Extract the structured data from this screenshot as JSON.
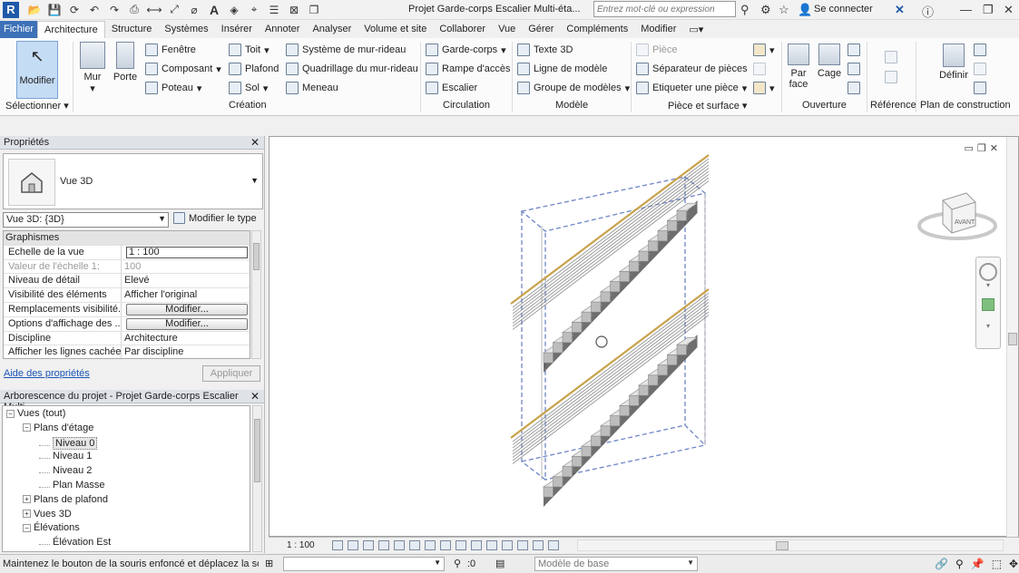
{
  "titlebar": {
    "app_letter": "R",
    "document_title": "Projet Garde-corps Escalier Multi-éta...",
    "search_placeholder": "Entrez mot-clé ou expression",
    "signin_label": "Se connecter"
  },
  "menu_tabs": [
    "Fichier",
    "Architecture",
    "Structure",
    "Systèmes",
    "Insérer",
    "Annoter",
    "Analyser",
    "Volume et site",
    "Collaborer",
    "Vue",
    "Gérer",
    "Compléments",
    "Modifier"
  ],
  "active_tab": "Architecture",
  "ribbon": {
    "select": {
      "modify_label": "Modifier",
      "panel_label": "Sélectionner"
    },
    "build": {
      "wall_label": "Mur",
      "door_label": "Porte",
      "window_label": "Fenêtre",
      "component_label": "Composant",
      "column_label": "Poteau",
      "roof_label": "Toit",
      "ceiling_label": "Plafond",
      "floor_label": "Sol",
      "curtain_system_label": "Système de mur-rideau",
      "curtain_grid_label": "Quadrillage du mur-rideau",
      "mullion_label": "Meneau",
      "panel_label": "Création"
    },
    "circulation": {
      "railing_label": "Garde-corps",
      "ramp_label": "Rampe d'accès",
      "stair_label": "Escalier",
      "panel_label": "Circulation"
    },
    "model": {
      "text_label": "Texte 3D",
      "line_label": "Ligne de modèle",
      "group_label": "Groupe de modèles",
      "panel_label": "Modèle"
    },
    "room": {
      "room_label": "Pièce",
      "separator_label": "Séparateur de pièces",
      "tag_label": "Etiqueter une pièce",
      "panel_label": "Pièce et surface"
    },
    "opening": {
      "by_face_label": "Par face",
      "shaft_label": "Cage",
      "panel_label": "Ouverture"
    },
    "datum": {
      "panel_label": "Référence"
    },
    "workplane": {
      "set_label": "Définir",
      "panel_label": "Plan de construction"
    }
  },
  "properties": {
    "header": "Propriétés",
    "type_name": "Vue 3D",
    "view_selector": "Vue 3D: {3D}",
    "edit_type_label": "Modifier le type",
    "group_label": "Graphismes",
    "rows": [
      {
        "key": "Echelle de la vue",
        "value": "1 : 100",
        "kind": "input"
      },
      {
        "key": "Valeur de l'échelle    1:",
        "value": "100",
        "kind": "dim"
      },
      {
        "key": "Niveau de détail",
        "value": "Elevé",
        "kind": "text"
      },
      {
        "key": "Visibilité des éléments",
        "value": "Afficher l'original",
        "kind": "text"
      },
      {
        "key": "Remplacements visibilité...",
        "value": "Modifier...",
        "kind": "button"
      },
      {
        "key": "Options d'affichage des ...",
        "value": "Modifier...",
        "kind": "button"
      },
      {
        "key": "Discipline",
        "value": "Architecture",
        "kind": "text"
      },
      {
        "key": "Afficher les lignes cachées",
        "value": "Par discipline",
        "kind": "text"
      }
    ],
    "help_link": "Aide des propriétés",
    "apply_label": "Appliquer"
  },
  "browser": {
    "header": "Arborescence du projet - Projet Garde-corps Escalier Multi...",
    "nodes": [
      {
        "label": "Vues (tout)",
        "level": 0,
        "toggle": "−"
      },
      {
        "label": "Plans d'étage",
        "level": 1,
        "toggle": "−"
      },
      {
        "label": "Niveau 0",
        "level": 2,
        "toggle": "",
        "selected": true
      },
      {
        "label": "Niveau 1",
        "level": 2,
        "toggle": ""
      },
      {
        "label": "Niveau 2",
        "level": 2,
        "toggle": ""
      },
      {
        "label": "Plan Masse",
        "level": 2,
        "toggle": ""
      },
      {
        "label": "Plans de plafond",
        "level": 1,
        "toggle": "+"
      },
      {
        "label": "Vues 3D",
        "level": 1,
        "toggle": "+"
      },
      {
        "label": "Élévations",
        "level": 1,
        "toggle": "−"
      },
      {
        "label": "Élévation Est",
        "level": 2,
        "toggle": ""
      }
    ]
  },
  "viewport": {
    "viewcube_face": "AVANT"
  },
  "view_control_bar": {
    "scale": "1 : 100"
  },
  "statusbar": {
    "message": "Maintenez le bouton de la souris enfoncé et déplacez la souris",
    "count": ":0",
    "model_placeholder": "Modèle de base"
  }
}
